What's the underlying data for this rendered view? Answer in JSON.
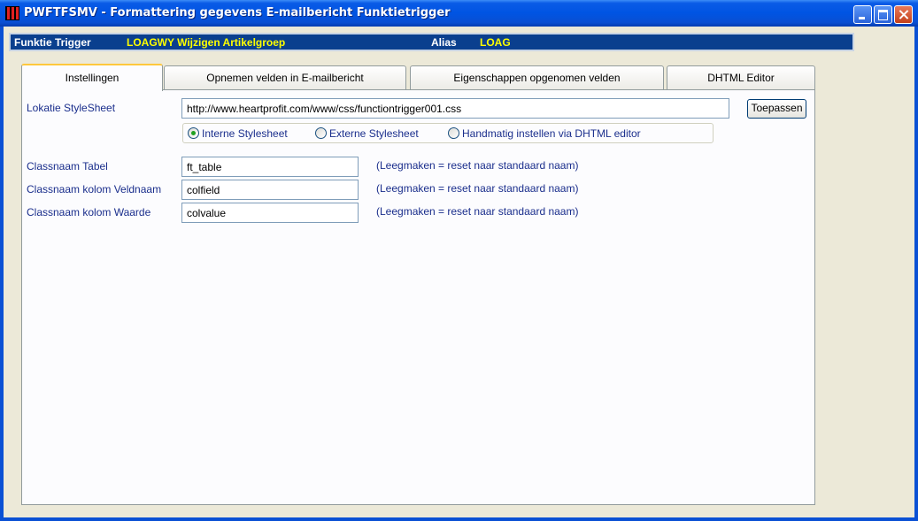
{
  "window": {
    "title": "PWFTFSMV - Formattering gegevens E-mailbericht Funktietrigger"
  },
  "infobar": {
    "trigger_label": "Funktie Trigger",
    "trigger_value": "LOAGWY Wijzigen Artikelgroep",
    "alias_label": "Alias",
    "alias_value": "LOAG"
  },
  "tabs": [
    {
      "label": "Instellingen",
      "active": true
    },
    {
      "label": "Opnemen velden in E-mailbericht",
      "active": false
    },
    {
      "label": "Eigenschappen opgenomen velden",
      "active": false
    },
    {
      "label": "DHTML Editor",
      "active": false
    }
  ],
  "stylesheet": {
    "label": "Lokatie StyleSheet",
    "value": "http://www.heartprofit.com/www/css/functiontrigger001.css",
    "apply_button": "Toepassen",
    "options": [
      {
        "label": "Interne Stylesheet",
        "selected": true
      },
      {
        "label": "Externe Stylesheet",
        "selected": false
      },
      {
        "label": "Handmatig instellen via DHTML editor",
        "selected": false
      }
    ]
  },
  "classnames": [
    {
      "label": "Classnaam Tabel",
      "value": "ft_table",
      "hint": "(Leegmaken = reset naar standaard naam)"
    },
    {
      "label": "Classnaam kolom Veldnaam",
      "value": "colfield",
      "hint": "(Leegmaken = reset naar standaard naam)"
    },
    {
      "label": "Classnaam kolom Waarde",
      "value": "colvalue",
      "hint": "(Leegmaken = reset naar standaard naam)"
    }
  ],
  "colors": {
    "titlebar": "#0054E3",
    "infobar": "#0A3F8E",
    "highlight_text": "#FFFF00",
    "label_text": "#1A2E8C",
    "active_tab_accent": "#FFC83C"
  }
}
